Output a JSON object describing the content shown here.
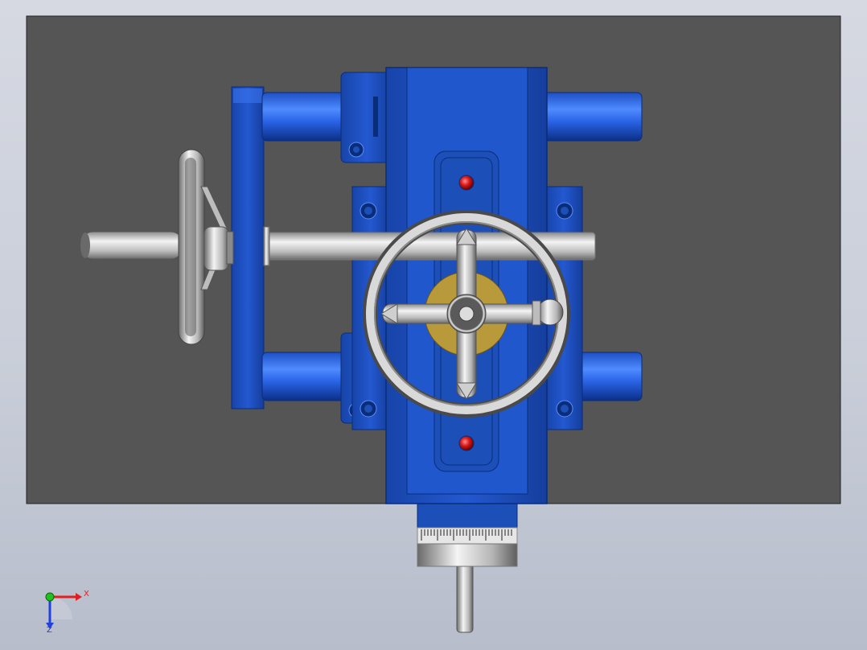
{
  "viewport": {
    "background_top": "#d6d9e2",
    "background_bottom": "#b7bdcb"
  },
  "colors": {
    "plate": "#555555",
    "body_blue": "#1c4fb8",
    "body_blue_light": "#3a78ff",
    "body_blue_dark": "#0a2d7a",
    "steel": "#c8c8c8",
    "steel_dark": "#6e6e6e",
    "indicator_red": "#d81818",
    "brass": "#b89a3a"
  },
  "triad": {
    "x_label": "X",
    "z_label": "Z",
    "x_color": "#e02020",
    "y_color": "#20c020",
    "z_color": "#2040e0"
  },
  "icons": {
    "triad": "coordinate-axes-icon",
    "handwheel": "handwheel-icon"
  }
}
